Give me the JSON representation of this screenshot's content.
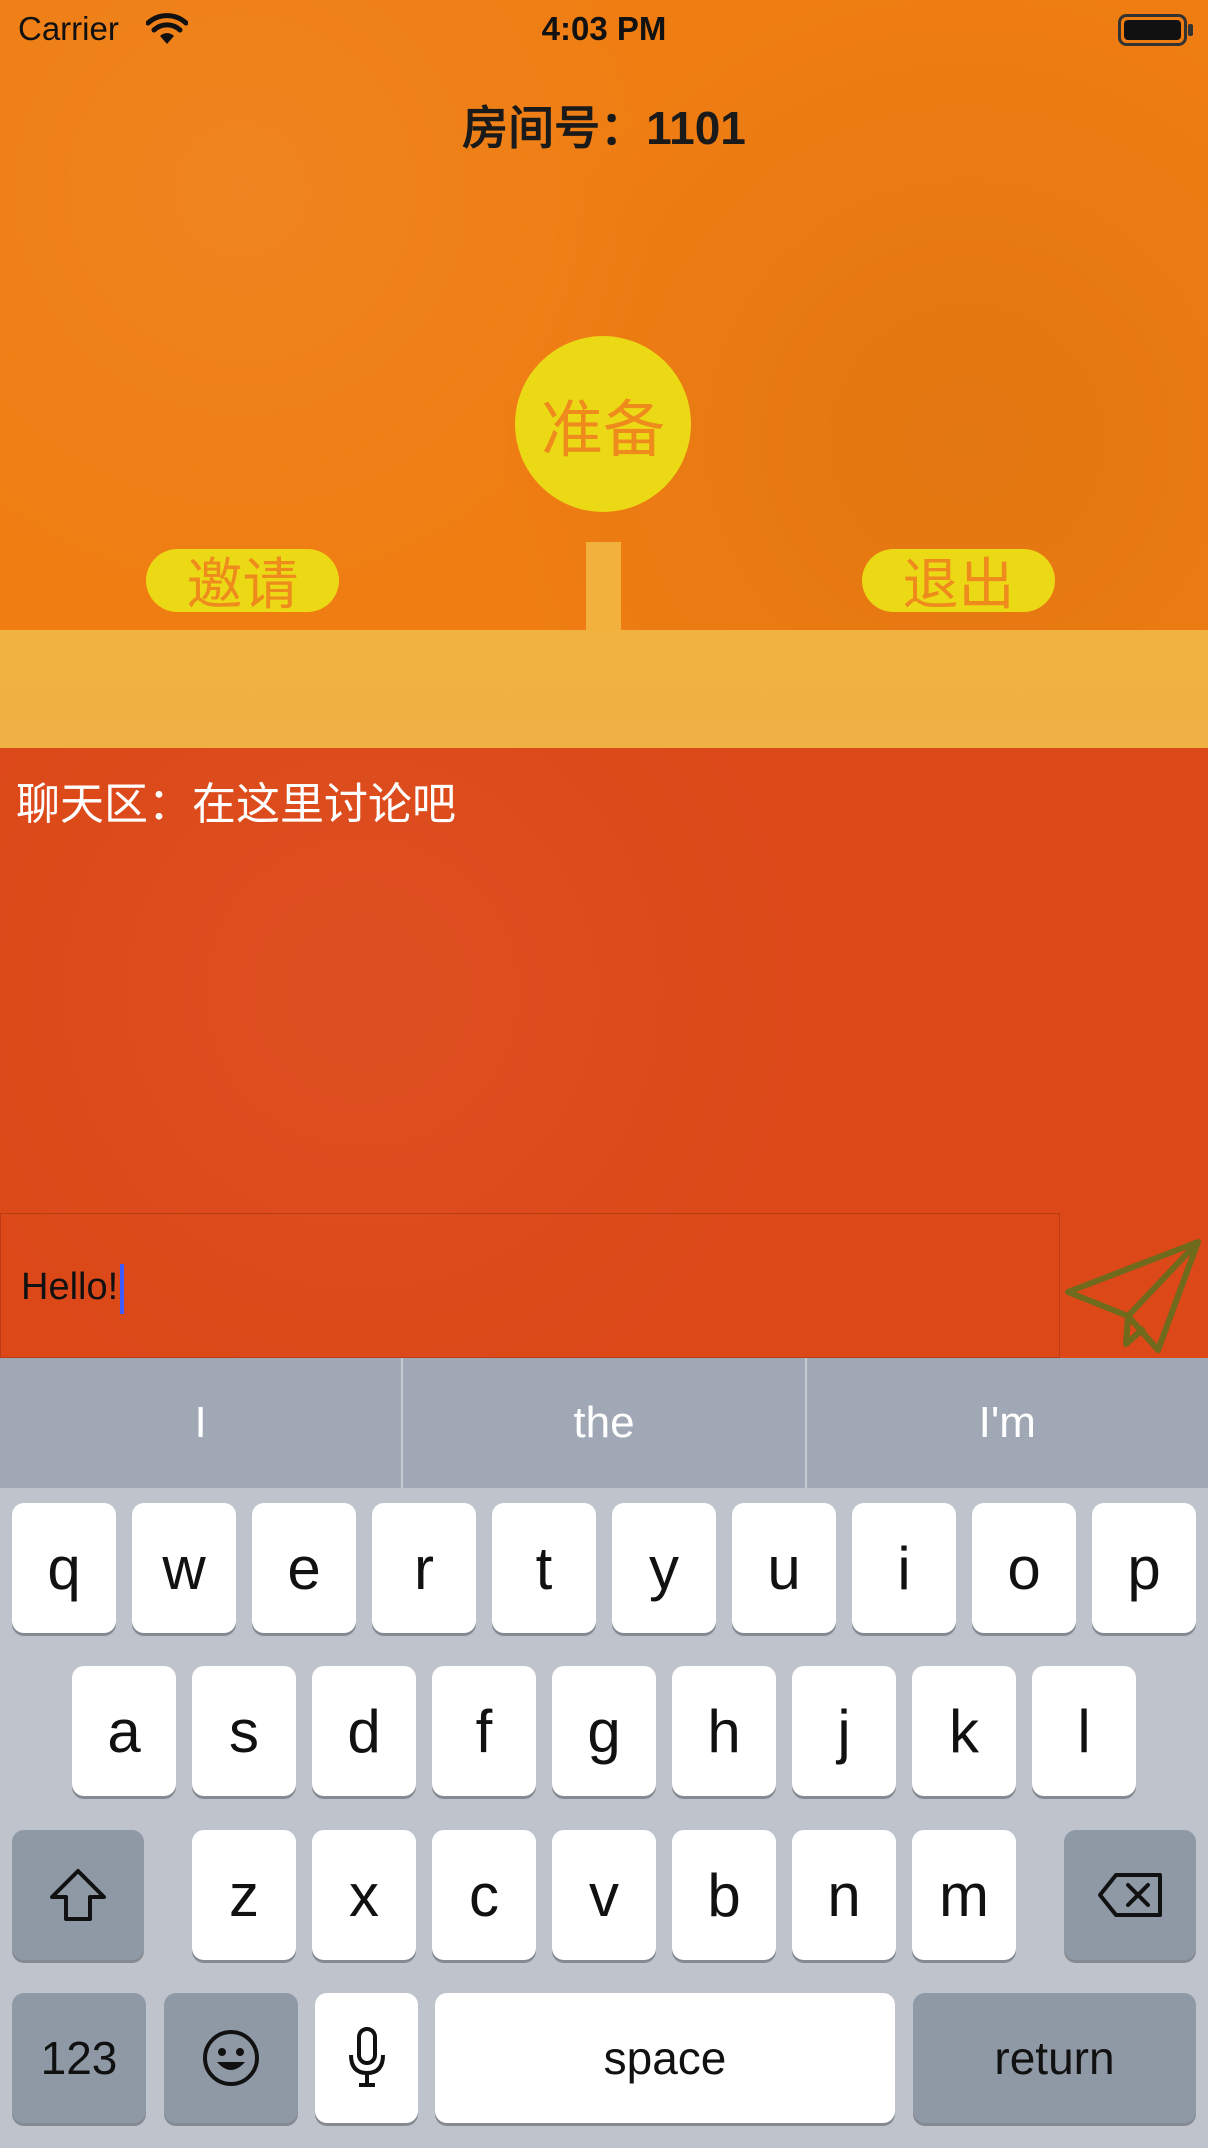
{
  "status_bar": {
    "carrier": "Carrier",
    "time": "4:03 PM",
    "wifi_icon": "wifi-icon",
    "battery_icon": "battery-icon"
  },
  "room": {
    "title": "房间号：1101"
  },
  "actions": {
    "ready_label": "准备",
    "invite_label": "邀请",
    "exit_label": "退出"
  },
  "chat": {
    "label": "聊天区：在这里讨论吧",
    "input_value": "Hello!",
    "send_icon": "paper-plane-icon"
  },
  "keyboard": {
    "suggestions": [
      "I",
      "the",
      "I'm"
    ],
    "row1": [
      "q",
      "w",
      "e",
      "r",
      "t",
      "y",
      "u",
      "i",
      "o",
      "p"
    ],
    "row2": [
      "a",
      "s",
      "d",
      "f",
      "g",
      "h",
      "j",
      "k",
      "l"
    ],
    "row3": [
      "z",
      "x",
      "c",
      "v",
      "b",
      "n",
      "m"
    ],
    "numbers_label": "123",
    "space_label": "space",
    "return_label": "return",
    "shift_icon": "shift-icon",
    "delete_icon": "backspace-icon",
    "emoji_icon": "emoji-icon",
    "mic_icon": "microphone-icon"
  },
  "colors": {
    "top_bg": "#ef7d12",
    "accent_yellow": "#ebd916",
    "button_text": "#ef8a1c",
    "band": "#f0b33f",
    "chat_bg": "#dc4818",
    "send_icon": "#6f6a1c",
    "cursor": "#3c5cff"
  }
}
